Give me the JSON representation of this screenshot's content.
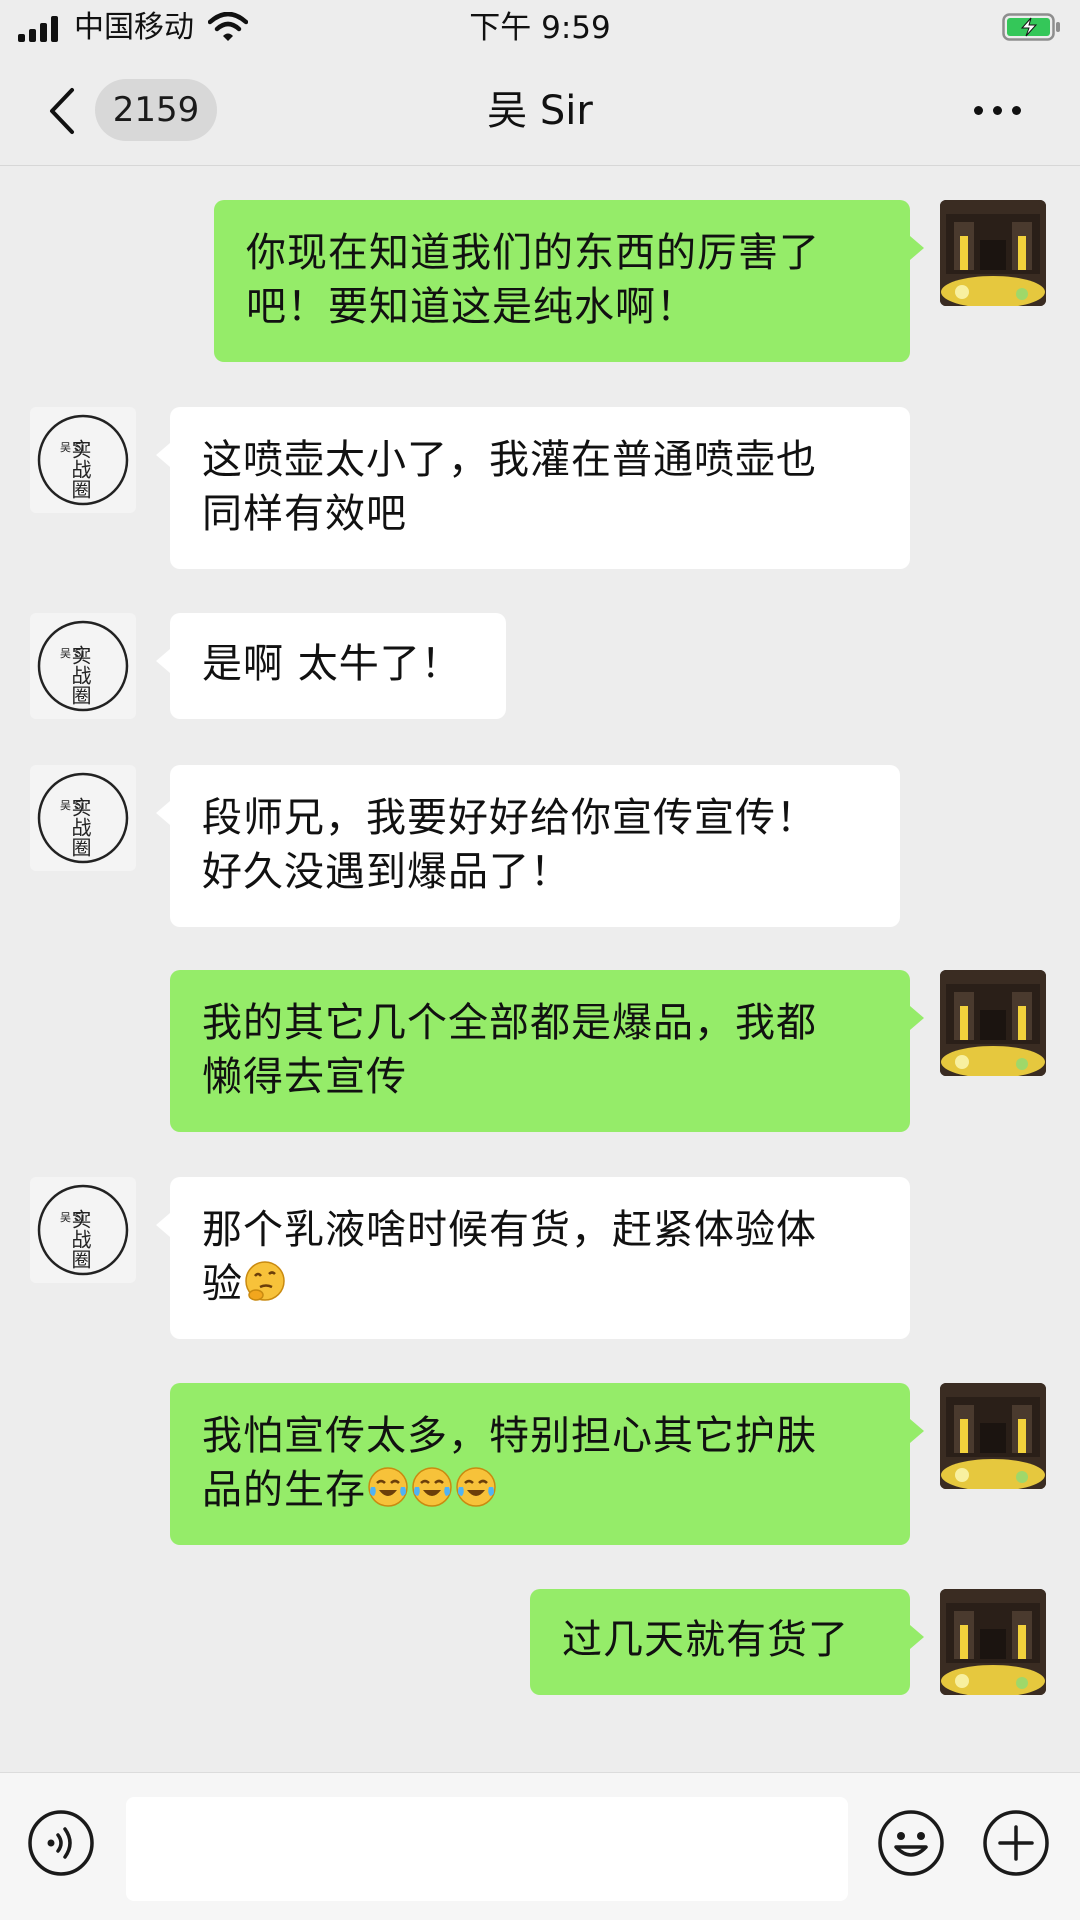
{
  "status_bar": {
    "carrier": "中国移动",
    "time": "下午 9:59"
  },
  "nav": {
    "unread_count": "2159",
    "title": "吴 Sir"
  },
  "contact_avatar": {
    "name": "吴 Sir",
    "stamp_text": "实战圈"
  },
  "messages": [
    {
      "from": "me",
      "lines": [
        "你现在知道我们的东西的厉害了",
        "吧！要知道这是纯水啊！"
      ]
    },
    {
      "from": "them",
      "lines": [
        "这喷壶太小了，我灌在普通喷壶也",
        "同样有效吧"
      ]
    },
    {
      "from": "them",
      "lines": [
        "是啊 太牛了！"
      ]
    },
    {
      "from": "them",
      "lines": [
        "段师兄，我要好好给你宣传宣传！",
        "好久没遇到爆品了！"
      ]
    },
    {
      "from": "me",
      "lines": [
        "我的其它几个全部都是爆品，我都",
        "懒得去宣传"
      ]
    },
    {
      "from": "them",
      "lines": [
        "那个乳液啥时候有货，赶紧体验体",
        "验"
      ],
      "emoji": [
        "thinking-face"
      ]
    },
    {
      "from": "me",
      "lines": [
        "我怕宣传太多，特别担心其它护肤",
        "品的生存"
      ],
      "emoji": [
        "tears-of-joy",
        "tears-of-joy",
        "tears-of-joy"
      ]
    },
    {
      "from": "me",
      "lines": [
        "过几天就有货了"
      ]
    }
  ],
  "icons": {
    "back": "chevron-left-icon",
    "more": "ellipsis-icon",
    "voice": "voice-icon",
    "emoji": "smiley-icon",
    "plus": "plus-circle-icon"
  },
  "colors": {
    "my_bubble": "#95ec69",
    "their_bubble": "#ffffff",
    "background": "#ededed"
  }
}
